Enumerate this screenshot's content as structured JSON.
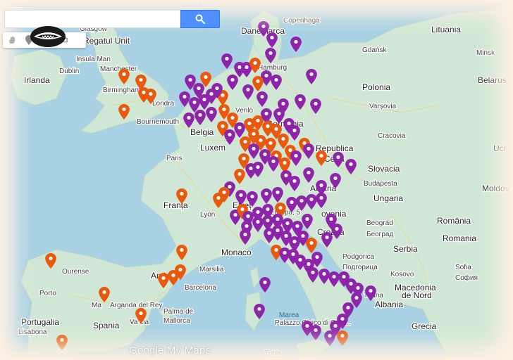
{
  "search": {
    "placeholder": "",
    "value": ""
  },
  "toolbar": {
    "tools": [
      "hand-tool",
      "marker-tool",
      "line-tool",
      "measure-tool"
    ]
  },
  "colors": {
    "marker_purple": "#8e24aa",
    "marker_orange": "#e8590c",
    "sea": "#a8d1e3",
    "land": "#cfe7d4"
  },
  "labels": {
    "water_top": "Marea",
    "glasgow": "Glasgow",
    "regatul_unit": "Regatul Unit",
    "insula_man": "Insula Man",
    "dublin": "Dublin",
    "manchester": "Manchester",
    "irlanda": "Irlanda",
    "birmingham": "Birmingham",
    "londra": "Londra",
    "bournemouth": "Bournemouth",
    "danemarca": "Danemarca",
    "copenhaga": "Copenhaga",
    "hamburg": "Hamburg",
    "gdansk": "Gdańsk",
    "lituania": "Lituania",
    "minsk": "Minsk",
    "belarus": "Belarus",
    "polonia": "Polonia",
    "varsovia": "Varșovia",
    "venlo": "Venlo",
    "germania": "Germania",
    "belgia": "Belgia",
    "luxembourg": "Luxem",
    "cracovia": "Cracovia",
    "republica": "Republica",
    "ceha": "Cehă",
    "paris": "Paris",
    "slovacia": "Slovacia",
    "budapesta": "Budapesta",
    "austria": "Austria",
    "ungaria": "Ungaria",
    "franta": "Franța",
    "lyon": "Lyon",
    "elvetia": "Elveț",
    "viale": "Viale Europa, 5",
    "slovenia": "ovenia",
    "croatia": "Croația",
    "beograd": "Beograd",
    "beograd_cyr": "Београд",
    "romania": "România",
    "romania_native": "Romania",
    "moldova": "Moldov",
    "ucraina": "Ucr",
    "serbia": "Serbia",
    "monaco": "Monaco",
    "marsilia": "Marsilia",
    "podgorica": "Podgorica",
    "podgorica_cyr": "Подгорица",
    "kosovo": "Kosovo",
    "sofia": "Sofia",
    "sofia_cyr": "София",
    "andorra": "Andorr",
    "barcelona": "Barcelona",
    "ourense": "Ourense",
    "porto": "Porto",
    "macedonia": "Macedonia",
    "de_nord": "de Nord",
    "tirana": "Tirana",
    "albania": "Albania",
    "madrid": "Ma",
    "arganda": "Arganda del Rey",
    "palma": "Palma de",
    "mallorca": "Mallorca",
    "marea": "Marea",
    "palazzo": "Palazzo Civico di Cagl...",
    "portugalia": "Portugalia",
    "lisabona": "Lisabona",
    "spania": "Spania",
    "valencia": "Va     cia",
    "grecia": "Grecia",
    "tunis": "Tunis"
  },
  "watermark": "Google My Maps"
}
